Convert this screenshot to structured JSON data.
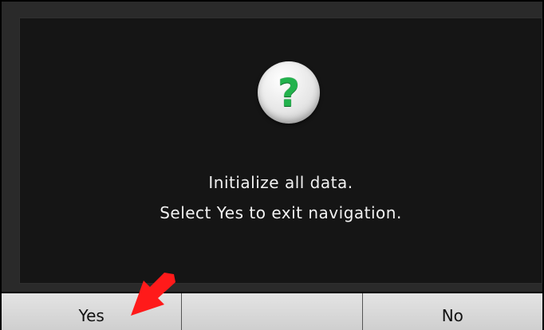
{
  "dialog": {
    "icon": "question-mark-icon",
    "icon_glyph": "?",
    "icon_color": "#22b24c",
    "message_line1": "Initialize all data.",
    "message_line2": "Select Yes to exit navigation."
  },
  "buttons": {
    "yes_label": "Yes",
    "middle_label": "",
    "no_label": "No"
  },
  "annotation": {
    "arrow_color": "#ff1a1a"
  }
}
